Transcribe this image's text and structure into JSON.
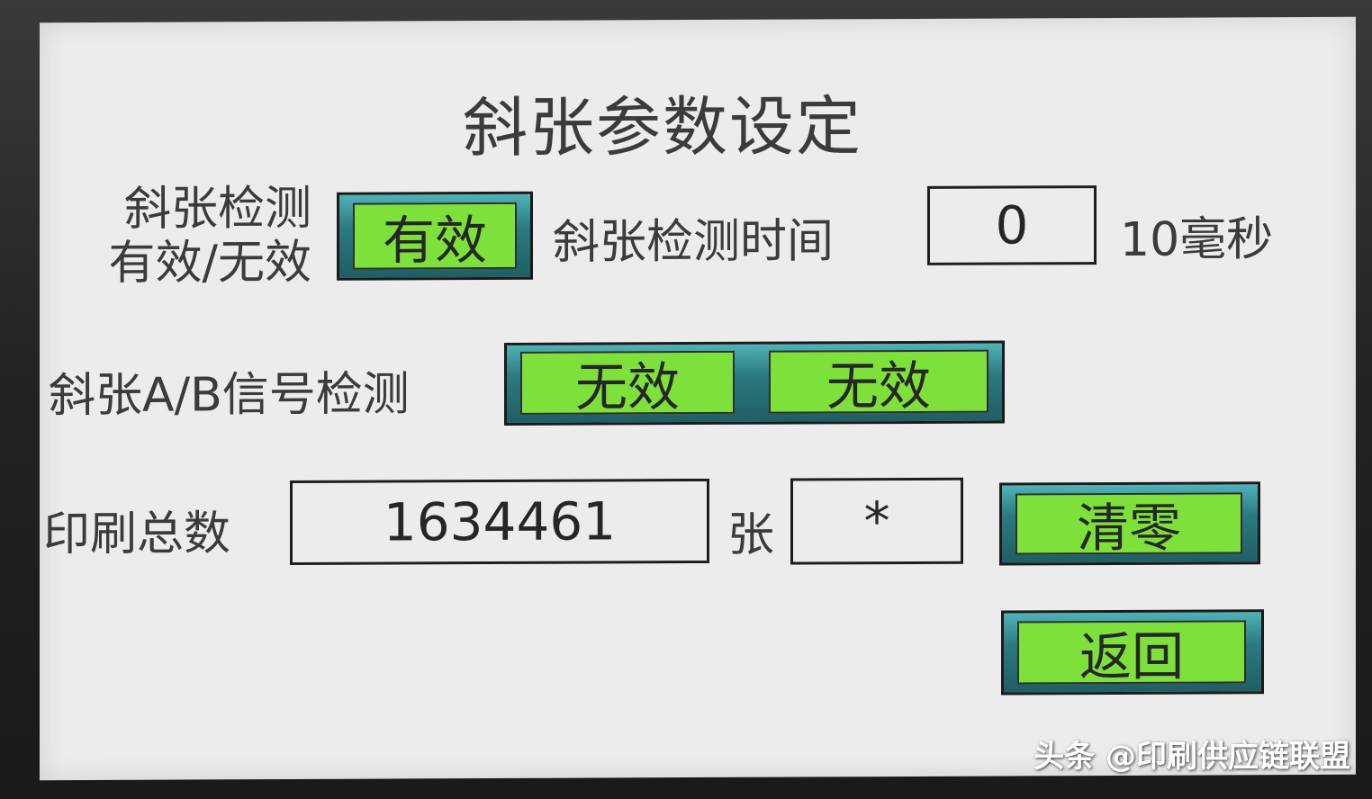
{
  "title": "斜张参数设定",
  "row1": {
    "label_line1": "斜张检测",
    "label_line2": "有效/无效",
    "enable_button": "有效",
    "time_label": "斜张检测时间",
    "time_value": "0",
    "time_unit": "10毫秒"
  },
  "row2": {
    "label": "斜张A/B信号检测",
    "a_button": "无效",
    "b_button": "无效"
  },
  "row3": {
    "label": "印刷总数",
    "total_value": "1634461",
    "unit": "张",
    "password_value": "*",
    "clear_button": "清零"
  },
  "footer": {
    "back_button": "返回"
  },
  "watermark": "头条 @印刷供应链联盟",
  "colors": {
    "button_green": "#7ee03a",
    "frame_teal": "#2b7a80",
    "screen_bg": "#ececec"
  }
}
